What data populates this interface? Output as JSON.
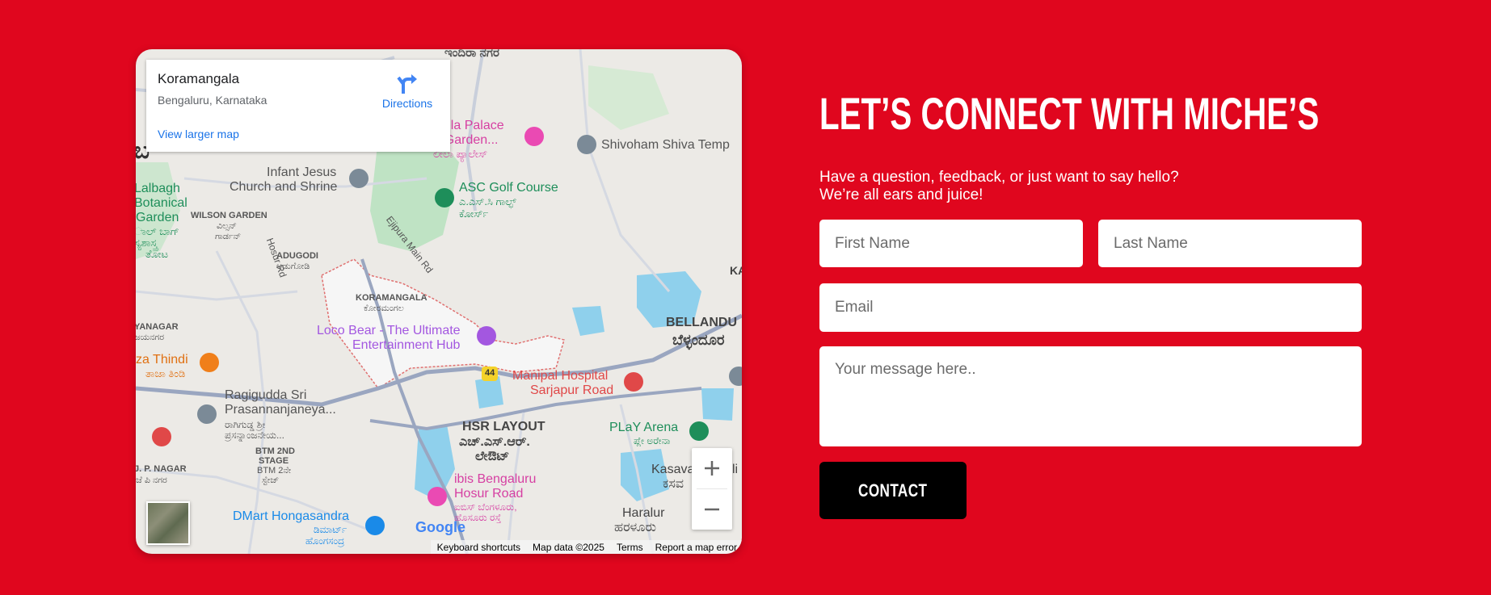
{
  "map": {
    "place_name": "Koramangala",
    "place_address": "Bengaluru, Karnataka",
    "directions_label": "Directions",
    "larger_map_label": "View larger map",
    "google_logo": "Google",
    "attribution": {
      "shortcuts": "Keyboard shortcuts",
      "map_data": "Map data ©2025",
      "terms": "Terms",
      "report": "Report a map error"
    },
    "labels": {
      "top_partial": "ಇಂದಿರಾ ನಗರ",
      "leela1": "eela Palace",
      "leela2": "- Garden...",
      "leela_kn": "ಲೀಲಾ ಪ್ಯಾಲೇಸ್",
      "shivoham": "Shivoham Shiva Temp",
      "infant1": "Infant Jesus",
      "infant2": "Church and Shrine",
      "asc1": "ASC Golf Course",
      "asc2": "ಎ.ಎಸ್.ಸಿ ಗಾಲ್ಫ್",
      "asc3": "ಕೋರ್ಸ್",
      "lalbagh1": "Lalbagh",
      "lalbagh2": "Botanical",
      "lalbagh3": "Garden",
      "lalbagh4": "ಾಲ್ ಬಾಗ್",
      "lalbagh5": "ಸ್ಯಶಾಸ್ತ್ರ",
      "lalbagh6": "ತೋಟ",
      "wilson1": "WILSON GARDEN",
      "wilson2": "ವಿಲ್ಸನ್",
      "wilson3": "ಗಾರ್ಡನ್",
      "hosur_rd": "Hosur Rd",
      "ejipura": "Ejipura Main Rd",
      "adugodi1": "ADUGODI",
      "adugodi2": "ಆಡುಗೋಡಿ",
      "koramangala1": "KORAMANGALA",
      "koramangala2": "ಕೋರಮಂಗಲ",
      "loco1": "Loco Bear - The Ultimate",
      "loco2": "Entertainment Hub",
      "bellandur1": "BELLANDU",
      "bellandur2": "ಬೆಳ್ಳಂದೂರ",
      "ka": "KA",
      "jayanagar1": "YANAGAR",
      "jayanagar2": "ಜಯನಗರ",
      "thindi1": "za Thindi",
      "thindi2": "ತಾಜಾ ತಿಂಡಿ",
      "highway": "44",
      "manipal1": "Manipal Hospital",
      "manipal2": "Sarjapur Road",
      "ragi1": "Ragigudda Sri",
      "ragi2": "Prasannanjaneya...",
      "ragi3": "ರಾಗಿಗುಡ್ಡ ಶ್ರೀ",
      "ragi4": "ಪ್ರಸನ್ನಾಂಜನೇಯ...",
      "hsr1": "HSR LAYOUT",
      "hsr2": "ಎಚ್.ಎಸ್.ಆರ್.",
      "hsr3": "ಲೇಔಟ್",
      "play1": "PLaY Arena",
      "play2": "ಪ್ಲೇ ಅರೇನಾ",
      "btm1": "BTM 2ND",
      "btm2": "STAGE",
      "btm3": "BTM 2ನೇ",
      "btm4": "ಸ್ಟೇಜ್",
      "jp1": "J. P. NAGAR",
      "jp2": "ಜೆ ಪಿ ನಗರ",
      "ibis1": "ibis Bengaluru",
      "ibis2": "Hosur Road",
      "ibis3": "ಐಬಿಸ್ ಬೆಂಗಳೂರು,",
      "ibis4": "ಹೊಸೂರು ರಸ್ತೆ",
      "kasav1": "Kasava",
      "kasav2": "ಕಸವ",
      "li": "li",
      "haralur1": "Haralur",
      "haralur2": "ಹರಳೂರು",
      "dmart1": "DMart Hongasandra",
      "dmart2": "ಡಿಮಾರ್ಟ್",
      "dmart3": "ಹೊಂಗಸಂದ್ರ",
      "top_left": "ಬ"
    }
  },
  "contact": {
    "heading": "LET’S CONNECT WITH MICHE’S",
    "subtitle_line1": "Have a question, feedback, or just want to say hello?",
    "subtitle_line2": "We’re all ears and juice!",
    "first_name_placeholder": "First Name",
    "last_name_placeholder": "Last Name",
    "email_placeholder": "Email",
    "message_placeholder": "Your message here..",
    "submit_label": "CONTACT"
  },
  "colors": {
    "page_background": "#e0061e",
    "button_background": "#000000",
    "link_blue": "#1a73e8"
  }
}
